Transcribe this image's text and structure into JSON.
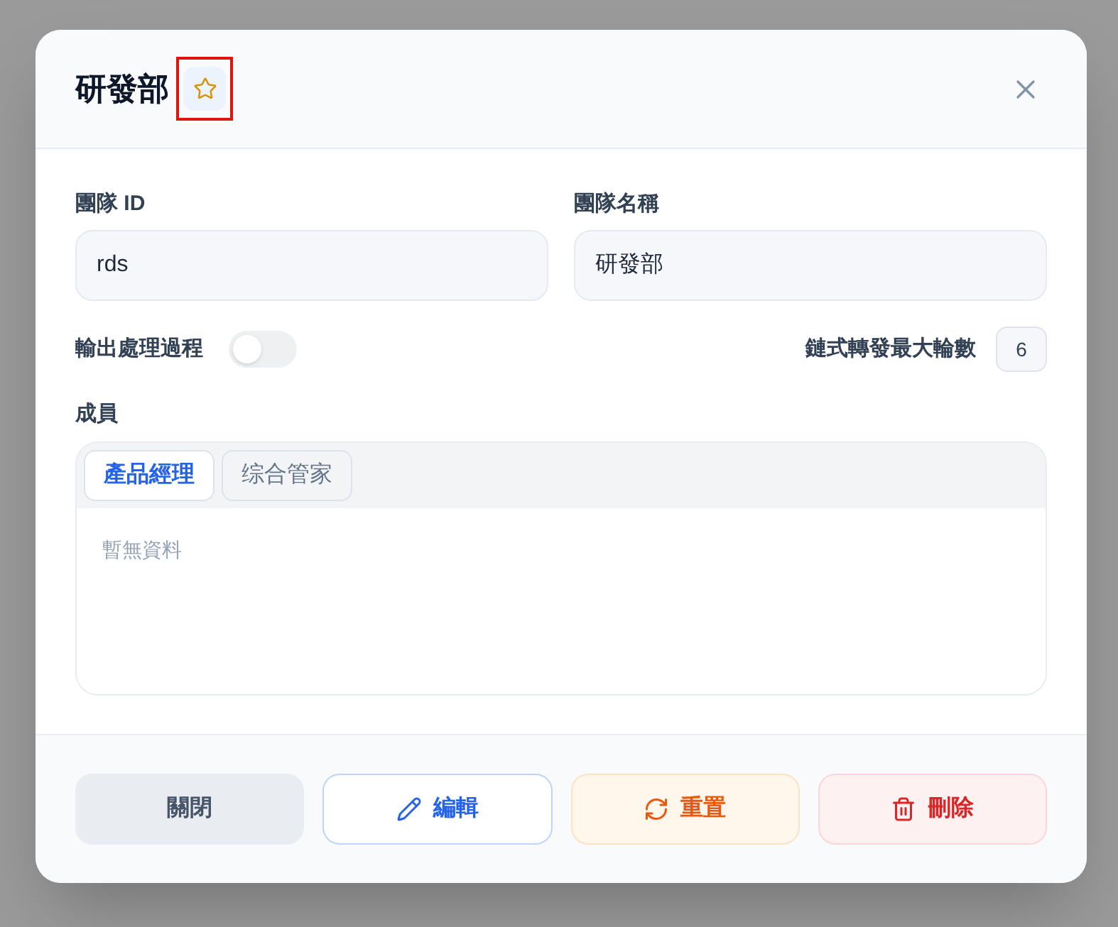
{
  "dialog": {
    "title": "研發部",
    "favorite": {
      "highlighted": true
    }
  },
  "fields": [
    {
      "label": "團隊 ID",
      "value": "rds"
    },
    {
      "label": "團隊名稱",
      "value": "研發部"
    }
  ],
  "options": {
    "show_process": {
      "label": "輸出處理過程",
      "on": false
    },
    "max_rounds": {
      "label": "鏈式轉發最大輪數",
      "value": "6"
    }
  },
  "members": {
    "label": "成員",
    "tabs": [
      {
        "label": "產品經理",
        "selected": true
      },
      {
        "label": "综合管家",
        "selected": false
      }
    ],
    "empty_text": "暫無資料"
  },
  "buttons": [
    {
      "kind": "close",
      "label": "關閉"
    },
    {
      "kind": "edit",
      "label": "編輯"
    },
    {
      "kind": "reset",
      "label": "重置"
    },
    {
      "kind": "delete",
      "label": "刪除"
    }
  ]
}
